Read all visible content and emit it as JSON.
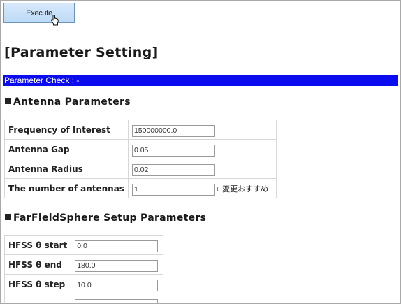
{
  "toolbar": {
    "execute_label": "Execute"
  },
  "page": {
    "title": "[Parameter Setting]"
  },
  "status": {
    "parameter_check": "Parameter Check : -"
  },
  "antenna": {
    "heading": "Antenna Parameters",
    "rows": [
      {
        "label": "Frequency of Interest",
        "value": "150000000.0"
      },
      {
        "label": "Antenna Gap",
        "value": "0.05"
      },
      {
        "label": "Antenna Radius",
        "value": "0.02"
      },
      {
        "label": "The number of antennas",
        "value": "1",
        "note": "←変更おすすめ"
      }
    ]
  },
  "farfield": {
    "heading": "FarFieldSphere Setup Parameters",
    "rows": [
      {
        "label": "HFSS θ start",
        "value": "0.0"
      },
      {
        "label": "HFSS θ end",
        "value": "180.0"
      },
      {
        "label": "HFSS θ step",
        "value": "10.0"
      },
      {
        "label": "",
        "value": ""
      }
    ]
  },
  "icons": {
    "cursor": "hand-pointer-icon",
    "section_marker": "black-square-icon"
  }
}
